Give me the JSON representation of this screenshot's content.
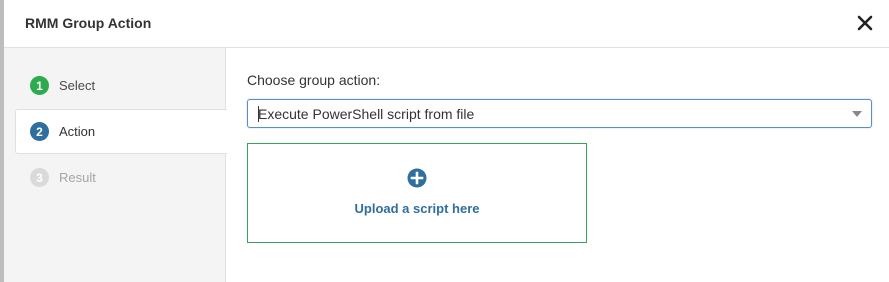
{
  "dialog": {
    "title": "RMM Group Action",
    "close_icon": "close-icon"
  },
  "steps": [
    {
      "number": "1",
      "label": "Select",
      "state": "completed",
      "color": "#2eaa4f"
    },
    {
      "number": "2",
      "label": "Action",
      "state": "active",
      "color": "#2f6e9e"
    },
    {
      "number": "3",
      "label": "Result",
      "state": "pending",
      "color": "#dadada"
    }
  ],
  "main": {
    "prompt": "Choose group action:",
    "selected_action": "Execute PowerShell script from file",
    "upload": {
      "icon": "plus-circle-icon",
      "label": "Upload a script here"
    }
  },
  "colors": {
    "accent_blue": "#2f6e9e",
    "success_green": "#2eaa4f",
    "upload_border": "#3aa35a"
  }
}
